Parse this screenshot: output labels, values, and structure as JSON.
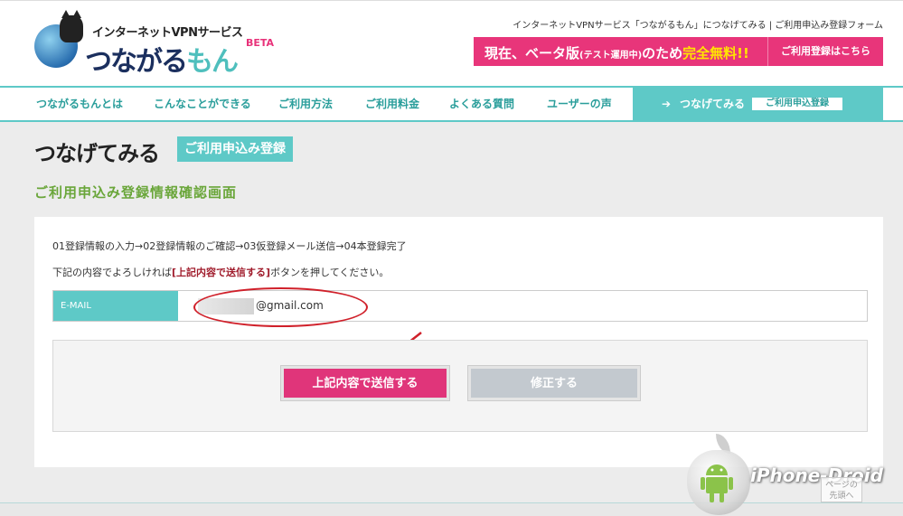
{
  "header": {
    "logo_sub": "インターネットVPNサービス",
    "logo_main_a": "つながる",
    "logo_main_b": "もん",
    "logo_beta": "BETA",
    "top_right": "インターネットVPNサービス「つながるもん」につなげてみる | ご利用申込み登録フォーム",
    "banner_text_a": "現在、ベータ版",
    "banner_text_small": "(テスト運用中)",
    "banner_text_b": "のため",
    "banner_text_c": "完全無料!!",
    "banner_link": "ご利用登録はこちら"
  },
  "nav": {
    "items": [
      "つながるもんとは",
      "こんなことができる",
      "ご利用方法",
      "ご利用料金",
      "よくある質問",
      "ユーザーの声"
    ],
    "cta_label": "つなげてみる",
    "cta_tag": "ご利用申込登録"
  },
  "page": {
    "title": "つなげてみる",
    "badge": "ご利用申込み登録",
    "subtitle": "ご利用申込み登録情報確認画面",
    "steps": "01登録情報の入力→02登録情報のご確認→03仮登録メール送信→04本登録完了",
    "instruction_a": "下記の内容でよろしければ",
    "instruction_b": "[上記内容で送信する]",
    "instruction_c": "ボタンを押してください。",
    "email_label": "E-MAIL",
    "email_value": "@gmail.com",
    "submit_label": "上記内容で送信する",
    "edit_label": "修正する"
  },
  "watermark": {
    "text": "iPhone-Droid",
    "top_link": "ページの先頭へ"
  },
  "colors": {
    "accent_teal": "#5ec9c7",
    "accent_pink": "#e0357a",
    "subtitle_green": "#6aa63a",
    "annotation_red": "#d0202a"
  }
}
